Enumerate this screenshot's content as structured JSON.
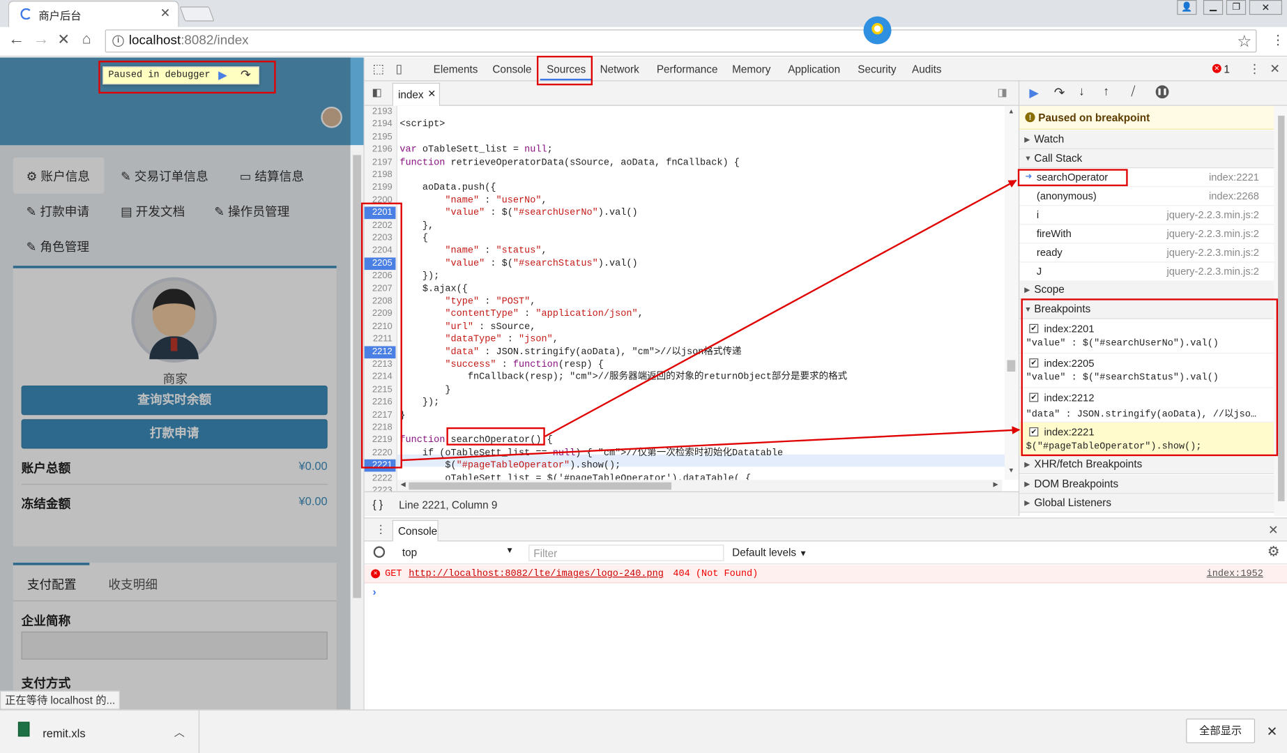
{
  "browser": {
    "tab_title": "商户后台",
    "url_host": "localhost",
    "url_rest": ":8082/index"
  },
  "debugger_overlay": {
    "label": "Paused in debugger"
  },
  "page": {
    "nav": [
      "账户信息",
      "交易订单信息",
      "结算信息",
      "打款申请",
      "开发文档",
      "操作员管理",
      "角色管理"
    ],
    "user_label": "商家",
    "btn_query": "查询实时余额",
    "btn_withdraw": "打款申请",
    "total_label": "账户总额",
    "total_value": "¥0.00",
    "frozen_label": "冻结金额",
    "frozen_value": "¥0.00",
    "tab_pay_config": "支付配置",
    "tab_income": "收支明细",
    "company_label": "企业简称",
    "pay_method_label": "支付方式"
  },
  "devtools": {
    "tabs": [
      "Elements",
      "Console",
      "Sources",
      "Network",
      "Performance",
      "Memory",
      "Application",
      "Security",
      "Audits"
    ],
    "active_tab": "Sources",
    "error_count": "1",
    "file_tab": "index",
    "status_line": "Line 2221, Column 9",
    "code_lines": [
      {
        "n": "2193",
        "t": ""
      },
      {
        "n": "2194",
        "t": "<script>"
      },
      {
        "n": "2195",
        "t": ""
      },
      {
        "n": "2196",
        "t": "var oTableSett_list = null;"
      },
      {
        "n": "2197",
        "t": "function retrieveOperatorData(sSource, aoData, fnCallback) {"
      },
      {
        "n": "2198",
        "t": ""
      },
      {
        "n": "2199",
        "t": "    aoData.push({"
      },
      {
        "n": "2200",
        "t": "        \"name\" : \"userNo\","
      },
      {
        "n": "2201",
        "t": "        \"value\" : $(\"#searchUserNo\").val()",
        "bp": true
      },
      {
        "n": "2202",
        "t": "    },"
      },
      {
        "n": "2203",
        "t": "    {"
      },
      {
        "n": "2204",
        "t": "        \"name\" : \"status\","
      },
      {
        "n": "2205",
        "t": "        \"value\" : $(\"#searchStatus\").val()",
        "bp": true
      },
      {
        "n": "2206",
        "t": "    });"
      },
      {
        "n": "2207",
        "t": "    $.ajax({"
      },
      {
        "n": "2208",
        "t": "        \"type\" : \"POST\","
      },
      {
        "n": "2209",
        "t": "        \"contentType\" : \"application/json\","
      },
      {
        "n": "2210",
        "t": "        \"url\" : sSource,"
      },
      {
        "n": "2211",
        "t": "        \"dataType\" : \"json\","
      },
      {
        "n": "2212",
        "t": "        \"data\" : JSON.stringify(aoData), //以json格式传递",
        "bp": true
      },
      {
        "n": "2213",
        "t": "        \"success\" : function(resp) {"
      },
      {
        "n": "2214",
        "t": "            fnCallback(resp); //服务器端返回的对象的returnObject部分是要求的格式"
      },
      {
        "n": "2215",
        "t": "        }"
      },
      {
        "n": "2216",
        "t": "    });"
      },
      {
        "n": "2217",
        "t": "}"
      },
      {
        "n": "2218",
        "t": ""
      },
      {
        "n": "2219",
        "t": "function searchOperator() {"
      },
      {
        "n": "2220",
        "t": "    if (oTableSett_list == null) { //仅第一次检索时初始化Datatable"
      },
      {
        "n": "2221",
        "t": "        $(\"#pageTableOperator\").show();",
        "bp": true
      },
      {
        "n": "2222",
        "t": "        oTableSett_list = $('#pageTableOperator').dataTable( {"
      },
      {
        "n": "2223",
        "t": ""
      }
    ],
    "paused_msg": "Paused on breakpoint",
    "sections": {
      "watch": "Watch",
      "call_stack": "Call Stack",
      "scope": "Scope",
      "breakpoints": "Breakpoints",
      "xhr": "XHR/fetch Breakpoints",
      "dom": "DOM Breakpoints",
      "global": "Global Listeners"
    },
    "call_stack": [
      {
        "fn": "searchOperator",
        "loc": "index:2221"
      },
      {
        "fn": "(anonymous)",
        "loc": "index:2268"
      },
      {
        "fn": "i",
        "loc": "jquery-2.2.3.min.js:2"
      },
      {
        "fn": "fireWith",
        "loc": "jquery-2.2.3.min.js:2"
      },
      {
        "fn": "ready",
        "loc": "jquery-2.2.3.min.js:2"
      },
      {
        "fn": "J",
        "loc": "jquery-2.2.3.min.js:2"
      }
    ],
    "breakpoints": [
      {
        "name": "index:2201",
        "code": "\"value\" : $(\"#searchUserNo\").val()"
      },
      {
        "name": "index:2205",
        "code": "\"value\" : $(\"#searchStatus\").val()"
      },
      {
        "name": "index:2212",
        "code": "\"data\" : JSON.stringify(aoData), //以jso…"
      },
      {
        "name": "index:2221",
        "code": "$(\"#pageTableOperator\").show();"
      }
    ],
    "console": {
      "tab": "Console",
      "context": "top",
      "filter_placeholder": "Filter",
      "levels": "Default levels",
      "error_method": "GET",
      "error_url": "http://localhost:8082/lte/images/logo-240.png",
      "error_status": "404 (Not Found)",
      "error_source": "index:1952"
    }
  },
  "statusbar": {
    "loading_text": "正在等待 localhost 的..."
  },
  "downloads": {
    "file": "remit.xls",
    "show_all": "全部显示"
  },
  "colors": {
    "accent_red": "#e00000",
    "breakpoint_blue": "#4a7fe3",
    "page_blue": "#3c8dbc"
  }
}
